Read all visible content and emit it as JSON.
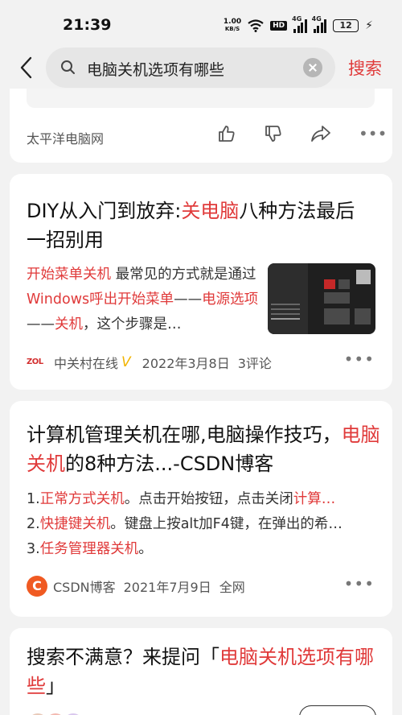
{
  "status_bar": {
    "time": "21:39",
    "net_speed_value": "1.00",
    "net_speed_unit": "KB/S",
    "hd_label": "HD",
    "signal1_label": "4G",
    "signal2_label": "4G",
    "battery_level": "12"
  },
  "search": {
    "query": "电脑关机选项有哪些",
    "submit_label": "搜索"
  },
  "results": [
    {
      "source": "太平洋电脑网"
    },
    {
      "title_parts": [
        "DIY从入门到放弃:",
        "关电脑",
        "八种方法最后一招别用"
      ],
      "snippet_parts": [
        "开始菜单关机",
        " 最常见的方式就是通过",
        "Windows呼出开始菜单",
        "——",
        "电源选项",
        "——",
        "关机",
        "，这个步骤是…"
      ],
      "source": "中关村在线",
      "verified_mark": "V",
      "date": "2022年3月8日",
      "comments": "3评论"
    },
    {
      "title_parts": [
        "计算机管理关机在哪,电脑操作技巧，",
        "电脑关机",
        "的8种方法...-CSDN博客"
      ],
      "line1_parts": [
        "1.",
        "正常方式关机",
        "。点击开始按钮，点击关闭",
        "计算…"
      ],
      "line2_parts": [
        "2.",
        "快捷键关机",
        "。键盘上按alt加F4键，在弹出的希…"
      ],
      "line3_parts": [
        "3.",
        "任务管理器关机",
        "。"
      ],
      "source": "CSDN博客",
      "logo_letter": "C",
      "date": "2021年7月9日",
      "scope": "全网"
    },
    {
      "title_parts": [
        "搜索不满意？来提问「",
        "电脑关机选项有哪些",
        "」"
      ]
    }
  ],
  "more_label": "•••",
  "zol_logo": "ZOL",
  "colors": {
    "accent": "#e03a3a",
    "background": "#f2f2f2",
    "card": "#ffffff",
    "csdn": "#f05a22",
    "verified": "#f2b400"
  },
  "icons": [
    "back-arrow-icon",
    "search-icon",
    "clear-icon",
    "thumbs-up-icon",
    "thumbs-down-icon",
    "share-icon",
    "more-icon",
    "wifi-icon",
    "signal-icon",
    "battery-icon",
    "charging-icon"
  ]
}
